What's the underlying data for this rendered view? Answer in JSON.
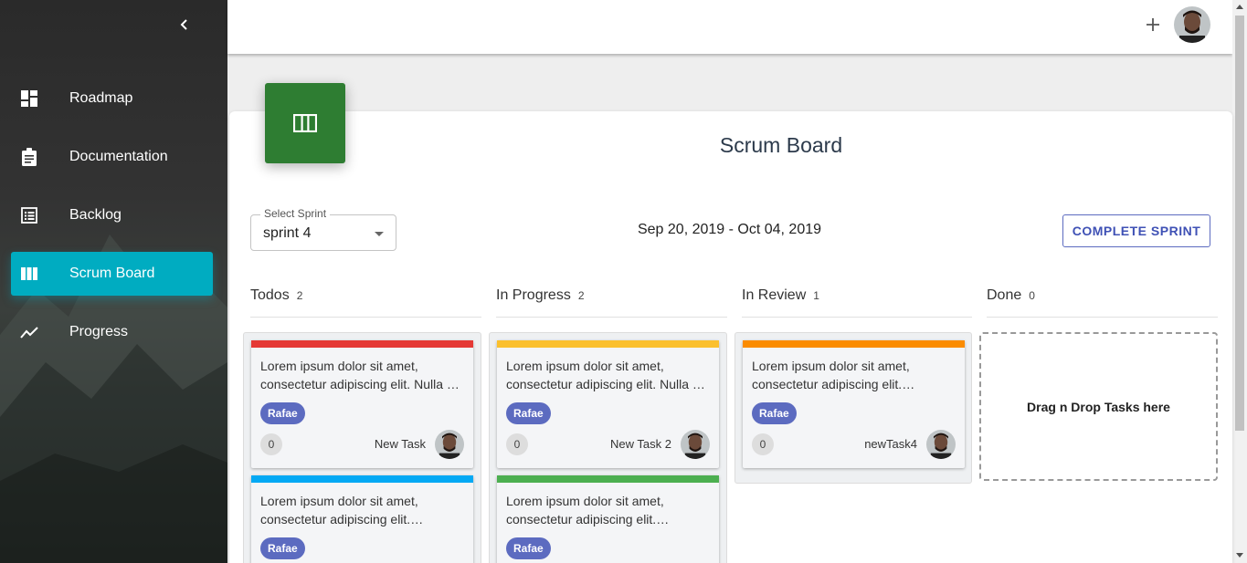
{
  "sidebar": {
    "items": [
      {
        "label": "Roadmap",
        "icon": "dashboard-icon"
      },
      {
        "label": "Documentation",
        "icon": "clipboard-icon"
      },
      {
        "label": "Backlog",
        "icon": "list-icon"
      },
      {
        "label": "Scrum Board",
        "icon": "columns-icon",
        "active": true
      },
      {
        "label": "Progress",
        "icon": "trending-up-icon"
      }
    ],
    "accent": "#00acc1"
  },
  "header": {
    "add_icon": "plus-icon",
    "avatar": "user-avatar"
  },
  "page": {
    "title": "Scrum Board",
    "icon_color": "#2e7d32"
  },
  "sprint": {
    "legend": "Select Sprint",
    "value": "sprint 4",
    "date_range": "Sep 20, 2019 - Oct 04, 2019",
    "complete_label": "COMPLETE SPRINT"
  },
  "columns": [
    {
      "name": "Todos",
      "count": "2"
    },
    {
      "name": "In Progress",
      "count": "2"
    },
    {
      "name": "In Review",
      "count": "1"
    },
    {
      "name": "Done",
      "count": "0"
    }
  ],
  "tasks": {
    "todo1": {
      "text": "Lorem ipsum dolor sit amet, consectetur adipiscing elit. Nulla …",
      "tag": "Rafae",
      "count": "0",
      "name": "New Task",
      "color": "#e53935"
    },
    "todo2": {
      "text": "Lorem ipsum dolor sit amet, consectetur adipiscing elit.…",
      "tag": "Rafae",
      "color": "#03a9f4"
    },
    "prog1": {
      "text": "Lorem ipsum dolor sit amet, consectetur adipiscing elit. Nulla …",
      "tag": "Rafae",
      "count": "0",
      "name": "New Task 2",
      "color": "#fbc02d"
    },
    "prog2": {
      "text": "Lorem ipsum dolor sit amet, consectetur adipiscing elit.…",
      "tag": "Rafae",
      "color": "#4caf50"
    },
    "rev1": {
      "text": "Lorem ipsum dolor sit amet, consectetur adipiscing elit.…",
      "tag": "Rafae",
      "count": "0",
      "name": "newTask4",
      "color": "#fb8c00"
    }
  },
  "dropzone": "Drag n Drop Tasks here"
}
